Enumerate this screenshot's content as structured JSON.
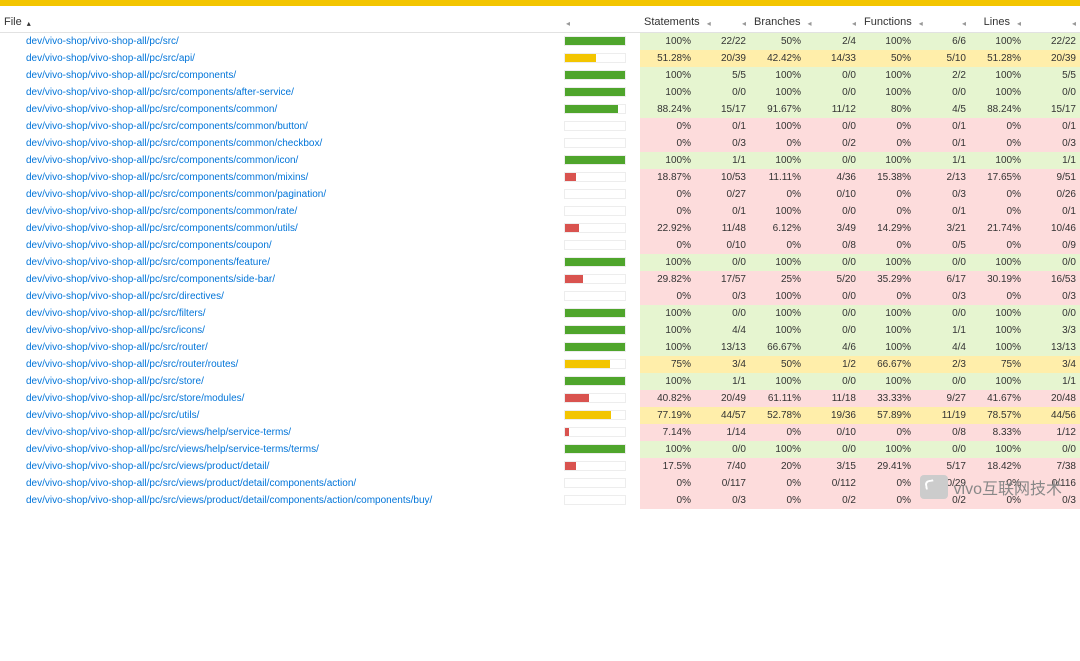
{
  "columns": {
    "file": "File",
    "statements": "Statements",
    "branches": "Branches",
    "functions": "Functions",
    "lines": "Lines"
  },
  "watermark_text": "vivo互联网技术",
  "rows": [
    {
      "file": "dev/vivo-shop/vivo-shop-all/pc/src/",
      "stmt_pct": "100%",
      "stmt": "22/22",
      "br_pct": "50%",
      "br": "2/4",
      "fn_pct": "100%",
      "fn": "6/6",
      "ln_pct": "100%",
      "ln": "22/22",
      "bar": 100,
      "cls": "high"
    },
    {
      "file": "dev/vivo-shop/vivo-shop-all/pc/src/api/",
      "stmt_pct": "51.28%",
      "stmt": "20/39",
      "br_pct": "42.42%",
      "br": "14/33",
      "fn_pct": "50%",
      "fn": "5/10",
      "ln_pct": "51.28%",
      "ln": "20/39",
      "bar": 51.28,
      "cls": "med"
    },
    {
      "file": "dev/vivo-shop/vivo-shop-all/pc/src/components/",
      "stmt_pct": "100%",
      "stmt": "5/5",
      "br_pct": "100%",
      "br": "0/0",
      "fn_pct": "100%",
      "fn": "2/2",
      "ln_pct": "100%",
      "ln": "5/5",
      "bar": 100,
      "cls": "high"
    },
    {
      "file": "dev/vivo-shop/vivo-shop-all/pc/src/components/after-service/",
      "stmt_pct": "100%",
      "stmt": "0/0",
      "br_pct": "100%",
      "br": "0/0",
      "fn_pct": "100%",
      "fn": "0/0",
      "ln_pct": "100%",
      "ln": "0/0",
      "bar": 100,
      "cls": "high"
    },
    {
      "file": "dev/vivo-shop/vivo-shop-all/pc/src/components/common/",
      "stmt_pct": "88.24%",
      "stmt": "15/17",
      "br_pct": "91.67%",
      "br": "11/12",
      "fn_pct": "80%",
      "fn": "4/5",
      "ln_pct": "88.24%",
      "ln": "15/17",
      "bar": 88.24,
      "cls": "high"
    },
    {
      "file": "dev/vivo-shop/vivo-shop-all/pc/src/components/common/button/",
      "stmt_pct": "0%",
      "stmt": "0/1",
      "br_pct": "100%",
      "br": "0/0",
      "fn_pct": "0%",
      "fn": "0/1",
      "ln_pct": "0%",
      "ln": "0/1",
      "bar": 0,
      "cls": "low"
    },
    {
      "file": "dev/vivo-shop/vivo-shop-all/pc/src/components/common/checkbox/",
      "stmt_pct": "0%",
      "stmt": "0/3",
      "br_pct": "0%",
      "br": "0/2",
      "fn_pct": "0%",
      "fn": "0/1",
      "ln_pct": "0%",
      "ln": "0/3",
      "bar": 0,
      "cls": "low"
    },
    {
      "file": "dev/vivo-shop/vivo-shop-all/pc/src/components/common/icon/",
      "stmt_pct": "100%",
      "stmt": "1/1",
      "br_pct": "100%",
      "br": "0/0",
      "fn_pct": "100%",
      "fn": "1/1",
      "ln_pct": "100%",
      "ln": "1/1",
      "bar": 100,
      "cls": "high"
    },
    {
      "file": "dev/vivo-shop/vivo-shop-all/pc/src/components/common/mixins/",
      "stmt_pct": "18.87%",
      "stmt": "10/53",
      "br_pct": "11.11%",
      "br": "4/36",
      "fn_pct": "15.38%",
      "fn": "2/13",
      "ln_pct": "17.65%",
      "ln": "9/51",
      "bar": 18.87,
      "cls": "low"
    },
    {
      "file": "dev/vivo-shop/vivo-shop-all/pc/src/components/common/pagination/",
      "stmt_pct": "0%",
      "stmt": "0/27",
      "br_pct": "0%",
      "br": "0/10",
      "fn_pct": "0%",
      "fn": "0/3",
      "ln_pct": "0%",
      "ln": "0/26",
      "bar": 0,
      "cls": "low"
    },
    {
      "file": "dev/vivo-shop/vivo-shop-all/pc/src/components/common/rate/",
      "stmt_pct": "0%",
      "stmt": "0/1",
      "br_pct": "100%",
      "br": "0/0",
      "fn_pct": "0%",
      "fn": "0/1",
      "ln_pct": "0%",
      "ln": "0/1",
      "bar": 0,
      "cls": "low"
    },
    {
      "file": "dev/vivo-shop/vivo-shop-all/pc/src/components/common/utils/",
      "stmt_pct": "22.92%",
      "stmt": "11/48",
      "br_pct": "6.12%",
      "br": "3/49",
      "fn_pct": "14.29%",
      "fn": "3/21",
      "ln_pct": "21.74%",
      "ln": "10/46",
      "bar": 22.92,
      "cls": "low"
    },
    {
      "file": "dev/vivo-shop/vivo-shop-all/pc/src/components/coupon/",
      "stmt_pct": "0%",
      "stmt": "0/10",
      "br_pct": "0%",
      "br": "0/8",
      "fn_pct": "0%",
      "fn": "0/5",
      "ln_pct": "0%",
      "ln": "0/9",
      "bar": 0,
      "cls": "low"
    },
    {
      "file": "dev/vivo-shop/vivo-shop-all/pc/src/components/feature/",
      "stmt_pct": "100%",
      "stmt": "0/0",
      "br_pct": "100%",
      "br": "0/0",
      "fn_pct": "100%",
      "fn": "0/0",
      "ln_pct": "100%",
      "ln": "0/0",
      "bar": 100,
      "cls": "high"
    },
    {
      "file": "dev/vivo-shop/vivo-shop-all/pc/src/components/side-bar/",
      "stmt_pct": "29.82%",
      "stmt": "17/57",
      "br_pct": "25%",
      "br": "5/20",
      "fn_pct": "35.29%",
      "fn": "6/17",
      "ln_pct": "30.19%",
      "ln": "16/53",
      "bar": 29.82,
      "cls": "low"
    },
    {
      "file": "dev/vivo-shop/vivo-shop-all/pc/src/directives/",
      "stmt_pct": "0%",
      "stmt": "0/3",
      "br_pct": "100%",
      "br": "0/0",
      "fn_pct": "0%",
      "fn": "0/3",
      "ln_pct": "0%",
      "ln": "0/3",
      "bar": 0,
      "cls": "low"
    },
    {
      "file": "dev/vivo-shop/vivo-shop-all/pc/src/filters/",
      "stmt_pct": "100%",
      "stmt": "0/0",
      "br_pct": "100%",
      "br": "0/0",
      "fn_pct": "100%",
      "fn": "0/0",
      "ln_pct": "100%",
      "ln": "0/0",
      "bar": 100,
      "cls": "high"
    },
    {
      "file": "dev/vivo-shop/vivo-shop-all/pc/src/icons/",
      "stmt_pct": "100%",
      "stmt": "4/4",
      "br_pct": "100%",
      "br": "0/0",
      "fn_pct": "100%",
      "fn": "1/1",
      "ln_pct": "100%",
      "ln": "3/3",
      "bar": 100,
      "cls": "high"
    },
    {
      "file": "dev/vivo-shop/vivo-shop-all/pc/src/router/",
      "stmt_pct": "100%",
      "stmt": "13/13",
      "br_pct": "66.67%",
      "br": "4/6",
      "fn_pct": "100%",
      "fn": "4/4",
      "ln_pct": "100%",
      "ln": "13/13",
      "bar": 100,
      "cls": "high"
    },
    {
      "file": "dev/vivo-shop/vivo-shop-all/pc/src/router/routes/",
      "stmt_pct": "75%",
      "stmt": "3/4",
      "br_pct": "50%",
      "br": "1/2",
      "fn_pct": "66.67%",
      "fn": "2/3",
      "ln_pct": "75%",
      "ln": "3/4",
      "bar": 75,
      "cls": "med"
    },
    {
      "file": "dev/vivo-shop/vivo-shop-all/pc/src/store/",
      "stmt_pct": "100%",
      "stmt": "1/1",
      "br_pct": "100%",
      "br": "0/0",
      "fn_pct": "100%",
      "fn": "0/0",
      "ln_pct": "100%",
      "ln": "1/1",
      "bar": 100,
      "cls": "high"
    },
    {
      "file": "dev/vivo-shop/vivo-shop-all/pc/src/store/modules/",
      "stmt_pct": "40.82%",
      "stmt": "20/49",
      "br_pct": "61.11%",
      "br": "11/18",
      "fn_pct": "33.33%",
      "fn": "9/27",
      "ln_pct": "41.67%",
      "ln": "20/48",
      "bar": 40.82,
      "cls": "low"
    },
    {
      "file": "dev/vivo-shop/vivo-shop-all/pc/src/utils/",
      "stmt_pct": "77.19%",
      "stmt": "44/57",
      "br_pct": "52.78%",
      "br": "19/36",
      "fn_pct": "57.89%",
      "fn": "11/19",
      "ln_pct": "78.57%",
      "ln": "44/56",
      "bar": 77.19,
      "cls": "med"
    },
    {
      "file": "dev/vivo-shop/vivo-shop-all/pc/src/views/help/service-terms/",
      "stmt_pct": "7.14%",
      "stmt": "1/14",
      "br_pct": "0%",
      "br": "0/10",
      "fn_pct": "0%",
      "fn": "0/8",
      "ln_pct": "8.33%",
      "ln": "1/12",
      "bar": 7.14,
      "cls": "low"
    },
    {
      "file": "dev/vivo-shop/vivo-shop-all/pc/src/views/help/service-terms/terms/",
      "stmt_pct": "100%",
      "stmt": "0/0",
      "br_pct": "100%",
      "br": "0/0",
      "fn_pct": "100%",
      "fn": "0/0",
      "ln_pct": "100%",
      "ln": "0/0",
      "bar": 100,
      "cls": "high"
    },
    {
      "file": "dev/vivo-shop/vivo-shop-all/pc/src/views/product/detail/",
      "stmt_pct": "17.5%",
      "stmt": "7/40",
      "br_pct": "20%",
      "br": "3/15",
      "fn_pct": "29.41%",
      "fn": "5/17",
      "ln_pct": "18.42%",
      "ln": "7/38",
      "bar": 17.5,
      "cls": "low"
    },
    {
      "file": "dev/vivo-shop/vivo-shop-all/pc/src/views/product/detail/components/action/",
      "stmt_pct": "0%",
      "stmt": "0/117",
      "br_pct": "0%",
      "br": "0/112",
      "fn_pct": "0%",
      "fn": "0/29",
      "ln_pct": "0%",
      "ln": "0/116",
      "bar": 0,
      "cls": "low"
    },
    {
      "file": "dev/vivo-shop/vivo-shop-all/pc/src/views/product/detail/components/action/components/buy/",
      "stmt_pct": "0%",
      "stmt": "0/3",
      "br_pct": "0%",
      "br": "0/2",
      "fn_pct": "0%",
      "fn": "0/2",
      "ln_pct": "0%",
      "ln": "0/3",
      "bar": 0,
      "cls": "low"
    }
  ]
}
